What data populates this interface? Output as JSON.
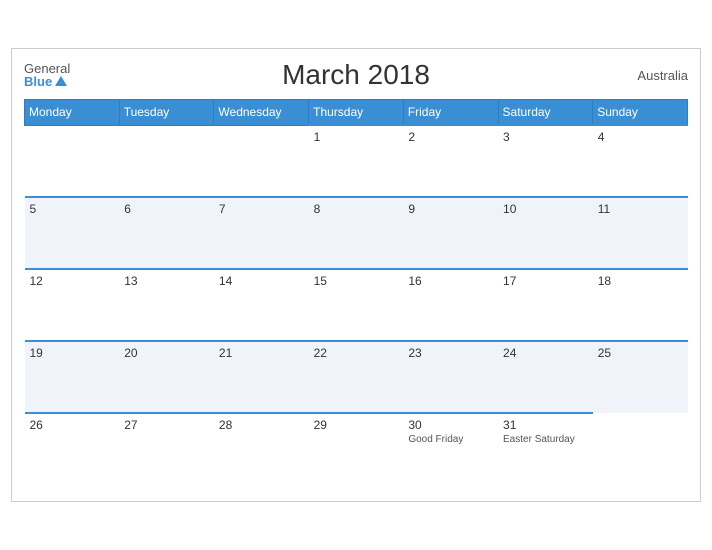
{
  "header": {
    "logo_general": "General",
    "logo_blue": "Blue",
    "title": "March 2018",
    "country": "Australia"
  },
  "weekdays": [
    "Monday",
    "Tuesday",
    "Wednesday",
    "Thursday",
    "Friday",
    "Saturday",
    "Sunday"
  ],
  "weeks": [
    [
      {
        "day": "",
        "holiday": ""
      },
      {
        "day": "",
        "holiday": ""
      },
      {
        "day": "",
        "holiday": ""
      },
      {
        "day": "1",
        "holiday": ""
      },
      {
        "day": "2",
        "holiday": ""
      },
      {
        "day": "3",
        "holiday": ""
      },
      {
        "day": "4",
        "holiday": ""
      }
    ],
    [
      {
        "day": "5",
        "holiday": ""
      },
      {
        "day": "6",
        "holiday": ""
      },
      {
        "day": "7",
        "holiday": ""
      },
      {
        "day": "8",
        "holiday": ""
      },
      {
        "day": "9",
        "holiday": ""
      },
      {
        "day": "10",
        "holiday": ""
      },
      {
        "day": "11",
        "holiday": ""
      }
    ],
    [
      {
        "day": "12",
        "holiday": ""
      },
      {
        "day": "13",
        "holiday": ""
      },
      {
        "day": "14",
        "holiday": ""
      },
      {
        "day": "15",
        "holiday": ""
      },
      {
        "day": "16",
        "holiday": ""
      },
      {
        "day": "17",
        "holiday": ""
      },
      {
        "day": "18",
        "holiday": ""
      }
    ],
    [
      {
        "day": "19",
        "holiday": ""
      },
      {
        "day": "20",
        "holiday": ""
      },
      {
        "day": "21",
        "holiday": ""
      },
      {
        "day": "22",
        "holiday": ""
      },
      {
        "day": "23",
        "holiday": ""
      },
      {
        "day": "24",
        "holiday": ""
      },
      {
        "day": "25",
        "holiday": ""
      }
    ],
    [
      {
        "day": "26",
        "holiday": ""
      },
      {
        "day": "27",
        "holiday": ""
      },
      {
        "day": "28",
        "holiday": ""
      },
      {
        "day": "29",
        "holiday": ""
      },
      {
        "day": "30",
        "holiday": "Good Friday"
      },
      {
        "day": "31",
        "holiday": "Easter Saturday"
      },
      {
        "day": "",
        "holiday": ""
      }
    ]
  ]
}
